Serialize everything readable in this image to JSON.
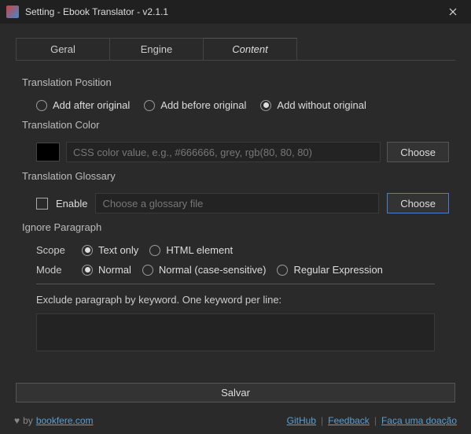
{
  "window": {
    "title": "Setting - Ebook Translator - v2.1.1"
  },
  "tabs": {
    "geral": "Geral",
    "engine": "Engine",
    "content": "Content"
  },
  "position": {
    "title": "Translation Position",
    "after": "Add after original",
    "before": "Add before original",
    "without": "Add without original"
  },
  "color": {
    "title": "Translation Color",
    "placeholder": "CSS color value, e.g., #666666, grey, rgb(80, 80, 80)",
    "choose": "Choose"
  },
  "glossary": {
    "title": "Translation Glossary",
    "enable": "Enable",
    "placeholder": "Choose a glossary file",
    "choose": "Choose"
  },
  "ignore": {
    "title": "Ignore Paragraph",
    "scope_label": "Scope",
    "scope_text": "Text only",
    "scope_html": "HTML element",
    "mode_label": "Mode",
    "mode_normal": "Normal",
    "mode_case": "Normal (case-sensitive)",
    "mode_regex": "Regular Expression",
    "exclude_label": "Exclude paragraph by keyword. One keyword per line:"
  },
  "save": "Salvar",
  "footer": {
    "by": "by",
    "site": "bookfere.com",
    "github": "GitHub",
    "feedback": "Feedback",
    "donate": "Faça uma doação"
  }
}
